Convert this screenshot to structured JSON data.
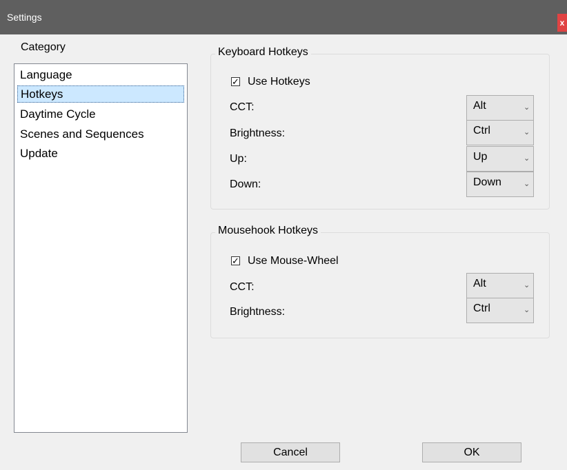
{
  "window": {
    "title": "Settings",
    "close_glyph": "x"
  },
  "sidebar": {
    "label": "Category",
    "items": [
      {
        "label": "Language",
        "selected": false
      },
      {
        "label": "Hotkeys",
        "selected": true
      },
      {
        "label": "Daytime Cycle",
        "selected": false
      },
      {
        "label": "Scenes and Sequences",
        "selected": false
      },
      {
        "label": "Update",
        "selected": false
      }
    ]
  },
  "keyboard": {
    "title": "Keyboard Hotkeys",
    "use_label": "Use Hotkeys",
    "use_checked": true,
    "fields": [
      {
        "label": "CCT:",
        "value": "Alt"
      },
      {
        "label": "Brightness:",
        "value": "Ctrl"
      },
      {
        "label": "Up:",
        "value": "Up"
      },
      {
        "label": "Down:",
        "value": "Down"
      }
    ]
  },
  "mouse": {
    "title": "Mousehook Hotkeys",
    "use_label": "Use Mouse-Wheel",
    "use_checked": true,
    "fields": [
      {
        "label": "CCT:",
        "value": "Alt"
      },
      {
        "label": "Brightness:",
        "value": "Ctrl"
      }
    ]
  },
  "icons": {
    "checkmark": "✓",
    "dropdown": "⌄"
  },
  "buttons": {
    "cancel": "Cancel",
    "ok": "OK"
  },
  "colors": {
    "titlebar": "#5f5f5f",
    "close": "#e04343",
    "selection": "#cce8ff"
  }
}
